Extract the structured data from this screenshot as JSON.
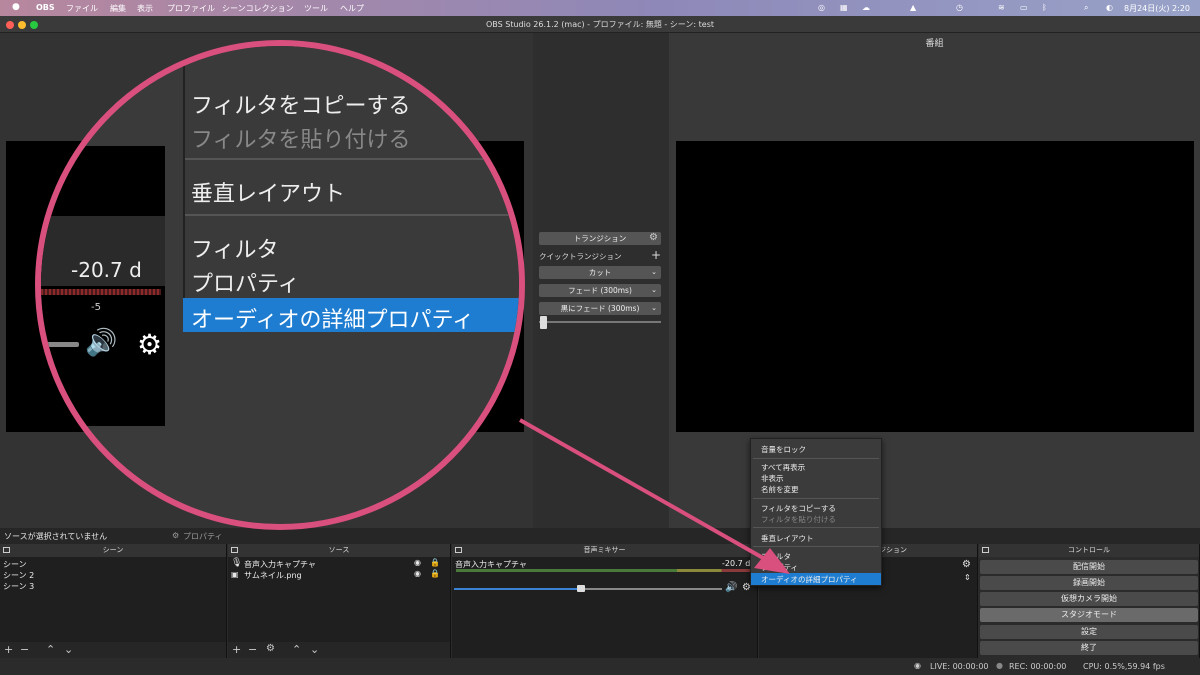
{
  "menubar": {
    "app": "OBS",
    "items": [
      "ファイル",
      "編集",
      "表示",
      "プロファイル",
      "シーンコレクション",
      "ツール",
      "ヘルプ"
    ],
    "clock": "8月24日(火) 2:20"
  },
  "window": {
    "title": "OBS Studio 26.1.2 (mac) - プロファイル: 無題 - シーン: test"
  },
  "program": {
    "label": "番組"
  },
  "transition": {
    "title": "トランジション",
    "quick": "クイックトランジション",
    "options": [
      "カット",
      "フェード (300ms)",
      "黒にフェード (300ms)"
    ]
  },
  "status": {
    "no_source": "ソースが選択されていません",
    "properties": "プロパティ"
  },
  "docks": {
    "scenes": {
      "title": "シーン",
      "items": [
        "シーン",
        "シーン 2",
        "シーン 3"
      ]
    },
    "sources": {
      "title": "ソース",
      "items": [
        "音声入力キャプチャ",
        "サムネイル.png"
      ]
    },
    "mixer": {
      "title": "音声ミキサー",
      "channel": "音声入力キャプチャ",
      "level": "-20.7 d"
    },
    "transitions": {
      "title": "ジション"
    },
    "controls": {
      "title": "コントロール",
      "buttons": [
        "配信開始",
        "録画開始",
        "仮想カメラ開始",
        "スタジオモード",
        "設定",
        "終了"
      ]
    }
  },
  "context_menu": {
    "items": [
      "音量をロック",
      "すべて再表示",
      "非表示",
      "名前を変更",
      "フィルタをコピーする",
      "フィルタを貼り付ける",
      "垂直レイアウト",
      "フィルタ",
      "プロパティ",
      "オーディオの詳細プロパティ"
    ],
    "highlight_color": "#1e7dd1"
  },
  "zoom": {
    "copy": "フィルタをコピーする",
    "paste": "フィルタを貼り付ける",
    "vertical": "垂直レイアウト",
    "filter": "フィルタ",
    "props": "プロパティ",
    "advanced": "オーディオの詳細プロパティ",
    "level": "-20.7 d",
    "tick": "-5"
  },
  "footer": {
    "live": "LIVE: 00:00:00",
    "rec": "REC: 00:00:00",
    "cpu": "CPU: 0.5%,59.94 fps"
  },
  "accent": {
    "pink": "#d94f7d",
    "blue": "#1e7dd1"
  }
}
